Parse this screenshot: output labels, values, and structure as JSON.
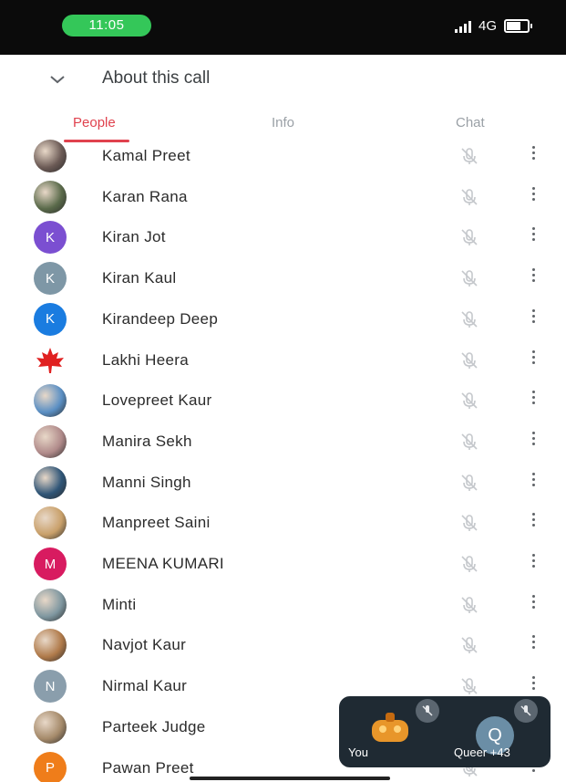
{
  "status_bar": {
    "time": "11:05",
    "network": "4G"
  },
  "header": {
    "title": "About this call"
  },
  "tabs": [
    {
      "label": "People",
      "active": true
    },
    {
      "label": "Info",
      "active": false
    },
    {
      "label": "Chat",
      "active": false
    }
  ],
  "participants": [
    {
      "name": "Kamal Preet",
      "avatar": {
        "type": "photo",
        "color": "#6b5a55"
      }
    },
    {
      "name": "Karan Rana",
      "avatar": {
        "type": "photo",
        "color": "#5a6a4a"
      }
    },
    {
      "name": "Kiran Jot",
      "avatar": {
        "type": "initial",
        "letter": "K",
        "color": "#7b4fd1"
      }
    },
    {
      "name": "Kiran Kaul",
      "avatar": {
        "type": "initial",
        "letter": "K",
        "color": "#7e97a6"
      }
    },
    {
      "name": "Kirandeep Deep",
      "avatar": {
        "type": "initial",
        "letter": "K",
        "color": "#1a7ce0"
      }
    },
    {
      "name": "Lakhi Heera",
      "avatar": {
        "type": "maple-leaf",
        "color": "#e02020"
      }
    },
    {
      "name": "Lovepreet Kaur",
      "avatar": {
        "type": "photo",
        "color": "#5a8fc4"
      }
    },
    {
      "name": "Manira Sekh",
      "avatar": {
        "type": "photo",
        "color": "#b08a8a"
      }
    },
    {
      "name": "Manni Singh",
      "avatar": {
        "type": "photo",
        "color": "#2f5577"
      }
    },
    {
      "name": "Manpreet Saini",
      "avatar": {
        "type": "photo",
        "color": "#c9a06a"
      }
    },
    {
      "name": "MEENA KUMARI",
      "avatar": {
        "type": "initial",
        "letter": "M",
        "color": "#d81b60"
      }
    },
    {
      "name": "Minti",
      "avatar": {
        "type": "photo",
        "color": "#7f97a0"
      }
    },
    {
      "name": "Navjot Kaur",
      "avatar": {
        "type": "photo",
        "color": "#b07a4a"
      }
    },
    {
      "name": "Nirmal Kaur",
      "avatar": {
        "type": "initial",
        "letter": "N",
        "color": "#8a9eac"
      }
    },
    {
      "name": "Parteek Judge",
      "avatar": {
        "type": "photo",
        "color": "#a58a6a"
      }
    },
    {
      "name": "Pawan Preet",
      "avatar": {
        "type": "initial",
        "letter": "P",
        "color": "#ef7d1a"
      }
    }
  ],
  "pip": {
    "self_label": "You",
    "other_label": "Queer +43",
    "other_initial": "Q"
  },
  "icons": {
    "chevron": "chevron-down-icon",
    "mic_muted": "mic-off-icon",
    "more": "more-vert-icon"
  }
}
